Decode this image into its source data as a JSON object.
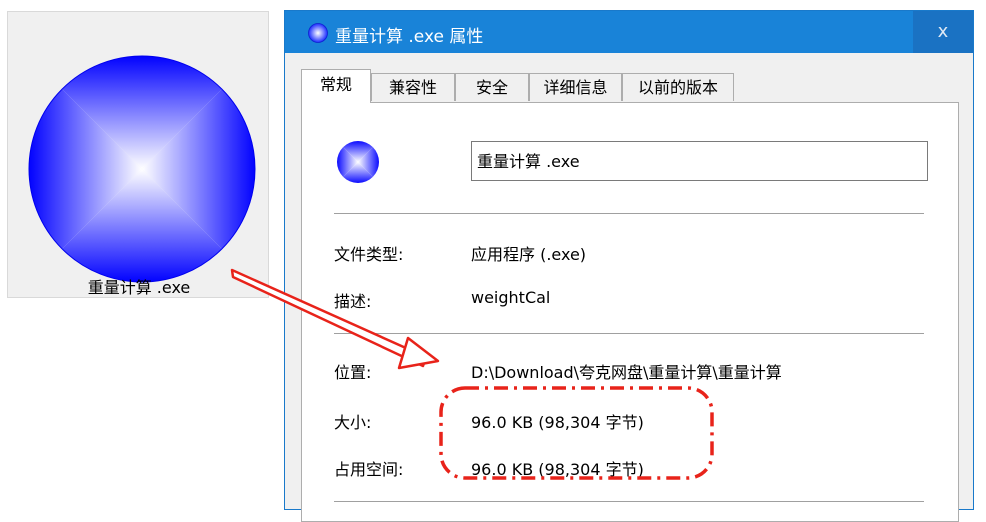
{
  "desktop_icon": {
    "caption": "重量计算 .exe"
  },
  "dialog": {
    "title": "重量计算 .exe 属性",
    "close_label": "x",
    "tabs": [
      "常规",
      "兼容性",
      "安全",
      "详细信息",
      "以前的版本"
    ],
    "active_tab": "常规",
    "file_name": "重量计算 .exe",
    "fields": {
      "type_label": "文件类型:",
      "type_value": "应用程序 (.exe)",
      "desc_label": "描述:",
      "desc_value": "weightCal",
      "location_label": "位置:",
      "location_value": "D:\\Download\\夸克网盘\\重量计算\\重量计算",
      "size_label": "大小:",
      "size_value": "96.0 KB (98,304 字节)",
      "disk_label": "占用空间:",
      "disk_value": "96.0 KB (98,304 字节)"
    }
  },
  "colors": {
    "titlebar": "#1983d8",
    "annotation": "#e8231a",
    "orb_edge": "#0000ff",
    "orb_center": "#ffffff"
  },
  "icons": [
    "app-orb-icon",
    "close-icon",
    "arrow-annotation",
    "highlight-annotation"
  ]
}
